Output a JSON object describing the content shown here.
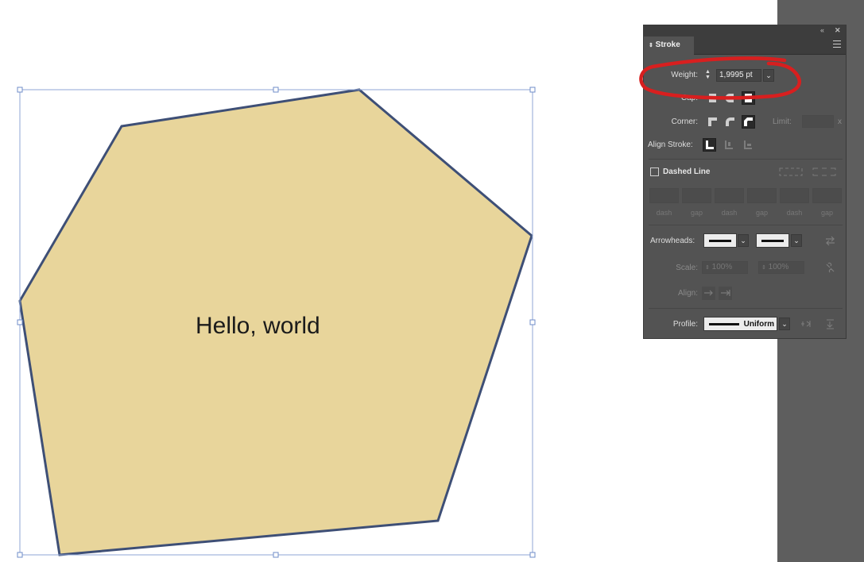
{
  "canvas": {
    "text": "Hello, world",
    "fill_color": "#e8d59b",
    "stroke_color": "#3e4f76",
    "selection_color": "#8fa6d6"
  },
  "panel": {
    "tab_title": "Stroke",
    "collapse_icon": "double-chevron-left-icon",
    "close_icon": "close-icon",
    "menu_icon": "hamburger-menu-icon",
    "weight": {
      "label": "Weight:",
      "value": "1,9995 pt"
    },
    "cap_label": "Cap:",
    "corner": {
      "label": "Corner:",
      "limit_label": "Limit:",
      "limit_suffix": "x"
    },
    "align_stroke_label": "Align Stroke:",
    "dashed_line": {
      "label": "Dashed Line",
      "checked": false,
      "fields": [
        "dash",
        "gap",
        "dash",
        "gap",
        "dash",
        "gap"
      ]
    },
    "arrowheads_label": "Arrowheads:",
    "scale": {
      "label": "Scale:",
      "start": "100%",
      "end": "100%"
    },
    "align_label": "Align:",
    "profile": {
      "label": "Profile:",
      "value": "Uniform"
    },
    "annotation_color": "#d81f1f"
  }
}
